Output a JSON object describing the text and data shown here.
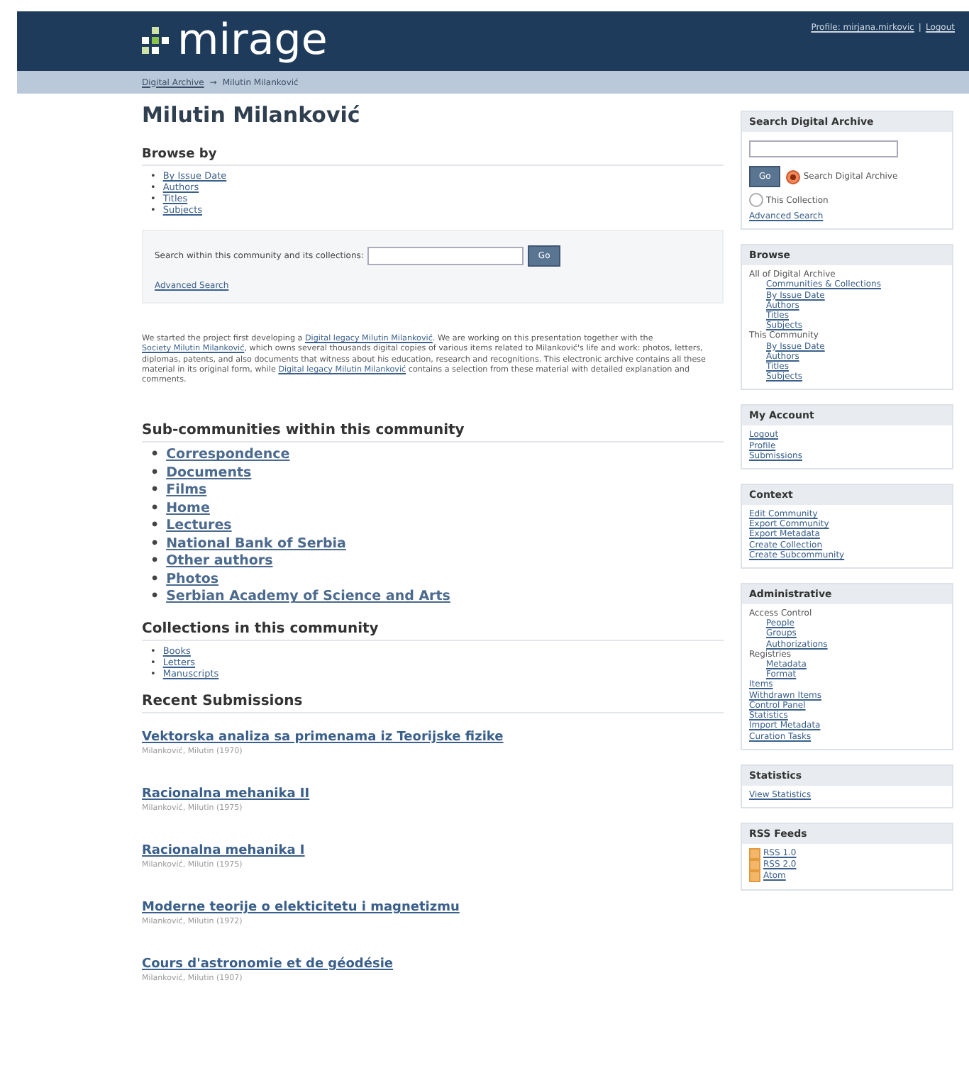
{
  "header": {
    "logo_text": "mirage",
    "user_links": [
      "Profile: mirjana.mirkovic",
      "Logout"
    ],
    "separator": "|"
  },
  "breadcrumbs": {
    "items": [
      "Digital Archive",
      "Milutin Milanković"
    ],
    "separator": "→"
  },
  "title": "Milutin Milanković",
  "browse_by": {
    "heading": "Browse by",
    "items": [
      "By Issue Date",
      "Authors",
      "Titles",
      "Subjects"
    ]
  },
  "community_search": {
    "label": "Search within this community and its collections:",
    "button": "Go",
    "link": "Advanced Search"
  },
  "list_marker": "•",
  "intro": [
    {
      "text": "We started the project first developing a ",
      "kind": "text"
    },
    {
      "text": "Digital legacy Milutin Milanković",
      "kind": "link"
    },
    {
      "text": ". We are working on this presentation together with the ",
      "kind": "text"
    },
    {
      "text": "Society Milutin Milanković",
      "kind": "link"
    },
    {
      "text": ", which owns several thousands digital copies of various items related to Milanković's life and work: photos, letters, diplomas, patents, and also documents that witness about his education, research and recognitions. This electronic archive contains all these material in its original form, while ",
      "kind": "text"
    },
    {
      "text": "Digital legacy Milutin Milanković",
      "kind": "link"
    },
    {
      "text": " contains a selection from these material with detailed explanation and comments.",
      "kind": "text"
    }
  ],
  "sub_communities": {
    "heading": "Sub-communities within this community",
    "items": [
      "Correspondence",
      "Documents",
      "Films",
      "Home",
      "Lectures",
      "National Bank of Serbia",
      "Other authors",
      "Photos",
      "Serbian Academy of Science and Arts"
    ]
  },
  "collections": {
    "heading": "Collections in this community",
    "items": [
      "Books",
      "Letters",
      "Manuscripts"
    ]
  },
  "recent_submissions": {
    "heading": "Recent Submissions",
    "items": [
      {
        "title": "Vektorska analiza sa primenama iz Teorijske fizike",
        "author": "Milanković, Milutin (1970)"
      },
      {
        "title": "Racionalna mehanika II",
        "author": "Milanković, Milutin (1975)"
      },
      {
        "title": "Racionalna mehanika I",
        "author": "Milanković, Milutin (1975)"
      },
      {
        "title": "Moderne teorije o elekticitetu i magnetizmu",
        "author": "Milanković, Milutin (1972)"
      },
      {
        "title": "Cours d'astronomie et de géodésie",
        "author": "Milanković, Milutin (1907)"
      }
    ]
  },
  "sidebar": [
    {
      "kind": "search",
      "title": "Search Digital Archive",
      "button": "Go",
      "options": [
        {
          "label": "Search Digital Archive",
          "selected": true
        },
        {
          "label": "This Collection",
          "selected": false
        }
      ],
      "link": "Advanced Search"
    },
    {
      "kind": "tree",
      "title": "Browse",
      "nodes": [
        {
          "label": "All of Digital Archive",
          "children": [
            {
              "label": "Communities & Collections"
            },
            {
              "label": "By Issue Date"
            },
            {
              "label": "Authors"
            },
            {
              "label": "Titles"
            },
            {
              "label": "Subjects"
            }
          ]
        },
        {
          "label": "This Community",
          "children": [
            {
              "label": "By Issue Date"
            },
            {
              "label": "Authors"
            },
            {
              "label": "Titles"
            },
            {
              "label": "Subjects"
            }
          ]
        }
      ]
    },
    {
      "kind": "tree",
      "title": "My Account",
      "nodes": [
        {
          "label": "Logout"
        },
        {
          "label": "Profile"
        },
        {
          "label": "Submissions"
        }
      ]
    },
    {
      "kind": "tree",
      "title": "Context",
      "nodes": [
        {
          "label": "Edit Community"
        },
        {
          "label": "Export Community"
        },
        {
          "label": "Export Metadata"
        },
        {
          "label": "Create Collection"
        },
        {
          "label": "Create Subcommunity"
        }
      ]
    },
    {
      "kind": "tree",
      "title": "Administrative",
      "nodes": [
        {
          "label": "Access Control",
          "children": [
            {
              "label": "People"
            },
            {
              "label": "Groups"
            },
            {
              "label": "Authorizations"
            }
          ]
        },
        {
          "label": "Registries",
          "children": [
            {
              "label": "Metadata"
            },
            {
              "label": "Format"
            }
          ]
        },
        {
          "label": "Items"
        },
        {
          "label": "Withdrawn Items"
        },
        {
          "label": "Control Panel"
        },
        {
          "label": "Statistics"
        },
        {
          "label": "Import Metadata"
        },
        {
          "label": "Curation Tasks"
        }
      ]
    },
    {
      "kind": "tree",
      "title": "Statistics",
      "nodes": [
        {
          "label": "View Statistics"
        }
      ]
    },
    {
      "kind": "feeds",
      "title": "RSS Feeds",
      "feeds": [
        "RSS 1.0",
        "RSS 2.0",
        "Atom"
      ]
    }
  ]
}
